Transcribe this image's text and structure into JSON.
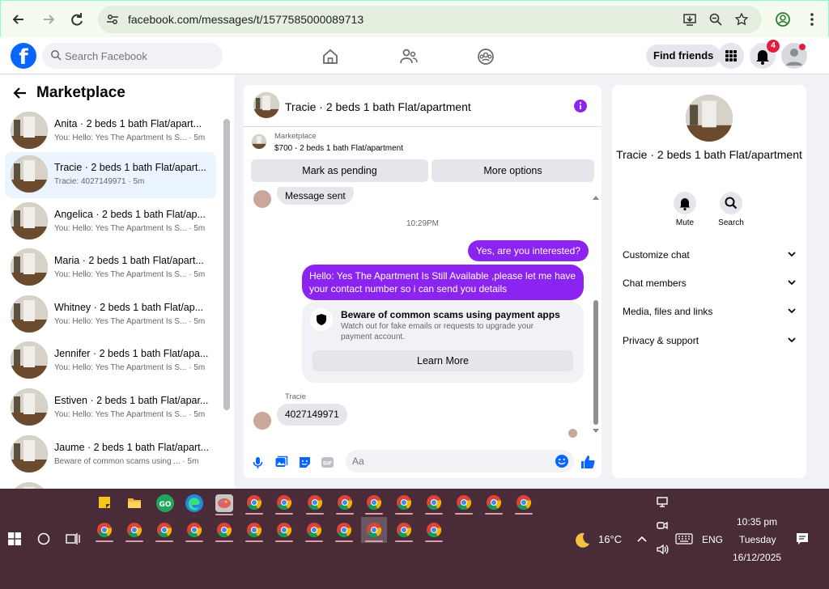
{
  "browser": {
    "url": "facebook.com/messages/t/1577585000089713"
  },
  "facebook": {
    "search_placeholder": "Search Facebook",
    "find_friends": "Find friends",
    "notification_count": "4"
  },
  "left": {
    "title": "Marketplace",
    "conversations": [
      {
        "name": "Anita · 2 beds 1 bath Flat/apart...",
        "preview": "You: Hello: Yes The Apartment Is S...",
        "time": "· 5m"
      },
      {
        "name": "Tracie · 2 beds 1 bath Flat/apart...",
        "preview": "Tracie: 4027149971",
        "time": "· 5m"
      },
      {
        "name": "Angelica · 2 beds 1 bath Flat/ap...",
        "preview": "You: Hello: Yes The Apartment Is S...",
        "time": "· 5m"
      },
      {
        "name": "Maria · 2 beds 1 bath Flat/apart...",
        "preview": "You: Hello: Yes The Apartment Is S...",
        "time": "· 5m"
      },
      {
        "name": "Whitney · 2 beds 1 bath Flat/ap...",
        "preview": "You: Hello: Yes The Apartment Is S...",
        "time": "· 5m"
      },
      {
        "name": "Jennifer · 2 beds 1 bath Flat/apa...",
        "preview": "You: Hello: Yes The Apartment Is S...",
        "time": "· 5m"
      },
      {
        "name": "Estiven · 2 beds 1 bath Flat/apar...",
        "preview": "You: Hello: Yes The Apartment Is S...",
        "time": "· 5m"
      },
      {
        "name": "Jaume · 2 beds 1 bath Flat/apart...",
        "preview": "Beware of common scams using ...",
        "time": "· 5m"
      }
    ]
  },
  "chat": {
    "title": "Tracie · 2 beds 1 bath Flat/apartment",
    "marketplace_label": "Marketplace",
    "listing": "$700 - 2 beds 1 bath Flat/apartment",
    "mark_pending": "Mark as pending",
    "more_options": "More options",
    "prev_message": "Message sent",
    "timestamp": "10:29PM",
    "out_msg_1": "Yes, are you interested?",
    "out_msg_2": "Hello: Yes The Apartment Is Still Available ,please let me have your contact number so i can send you details",
    "warning_title": "Beware of common scams using payment apps",
    "warning_body": "Watch out for fake emails or requests to upgrade your payment account.",
    "learn_more": "Learn More",
    "sender": "Tracie",
    "in_msg": "4027149971",
    "input_placeholder": "Aa"
  },
  "right": {
    "name": "Tracie · 2 beds 1 bath Flat/apartment",
    "mute": "Mute",
    "search": "Search",
    "items": [
      "Customize chat",
      "Chat members",
      "Media, files and links",
      "Privacy & support"
    ]
  },
  "taskbar": {
    "weather": "16°C",
    "language": "ENG",
    "time": "10:35 pm",
    "day": "Tuesday",
    "date": "16/12/2025"
  },
  "colors": {
    "facebook_blue": "#0866ff",
    "messenger_purple": "#8b24f0",
    "taskbar": "#4a2c39"
  }
}
